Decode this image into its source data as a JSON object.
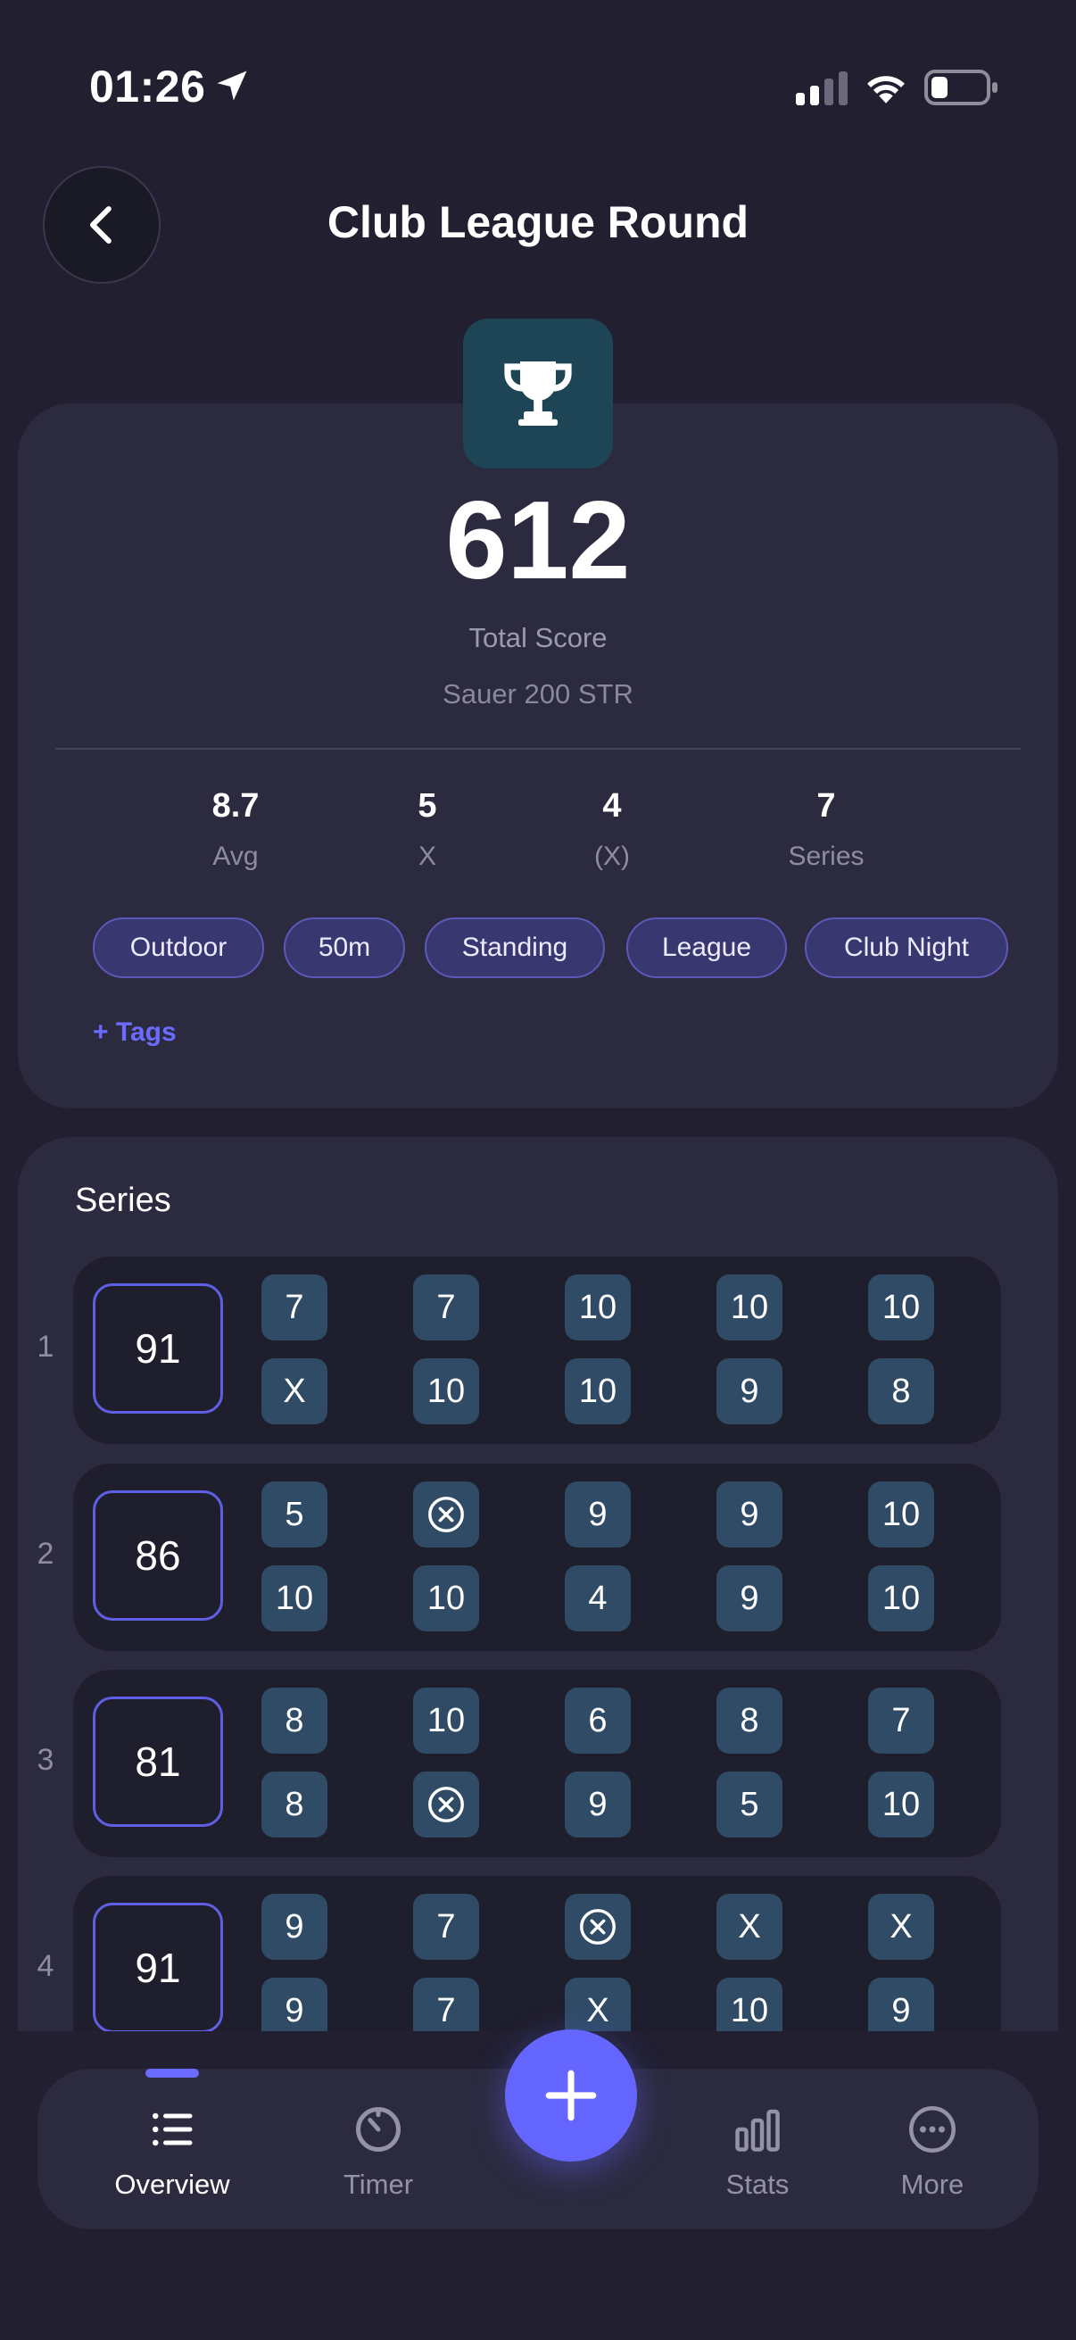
{
  "status_bar": {
    "time": "01:26"
  },
  "header": {
    "title": "Club League Round"
  },
  "summary": {
    "total_score": "612",
    "total_label": "Total Score",
    "rifle": "Sauer 200 STR",
    "stats": [
      {
        "value": "8.7",
        "label": "Avg"
      },
      {
        "value": "5",
        "label": "X"
      },
      {
        "value": "4",
        "label": "(X)"
      },
      {
        "value": "7",
        "label": "Series"
      }
    ],
    "tags": [
      "Outdoor",
      "50m",
      "Standing",
      "League",
      "Club Night"
    ],
    "add_tags_label": "+ Tags"
  },
  "series_section": {
    "title": "Series",
    "rows": [
      {
        "number": "1",
        "total": "91",
        "top": [
          "7",
          "7",
          "10",
          "10",
          "10"
        ],
        "bottom": [
          "X",
          "10",
          "10",
          "9",
          "8"
        ]
      },
      {
        "number": "2",
        "total": "86",
        "top": [
          "5",
          "",
          "9",
          "9",
          "10"
        ],
        "bottom": [
          "10",
          "10",
          "4",
          "9",
          "10"
        ]
      },
      {
        "number": "3",
        "total": "81",
        "top": [
          "8",
          "10",
          "6",
          "8",
          "7"
        ],
        "bottom": [
          "8",
          "",
          "9",
          "5",
          "10"
        ]
      },
      {
        "number": "4",
        "total": "91",
        "top": [
          "9",
          "7",
          "",
          "X",
          "X"
        ],
        "bottom": [
          "9",
          "7",
          "X",
          "10",
          "9"
        ]
      }
    ]
  },
  "nav": {
    "items": [
      {
        "label": "Overview",
        "icon": "list-icon"
      },
      {
        "label": "Timer",
        "icon": "timer-icon"
      },
      {
        "label": "Stats",
        "icon": "bar-chart-icon"
      },
      {
        "label": "More",
        "icon": "more-icon"
      }
    ],
    "active": "Overview"
  },
  "colors": {
    "background": "#211f30",
    "card": "#2c2a3e",
    "accent": "#6466ff",
    "shot_tile": "#2f4b66",
    "trophy_badge": "#1e4556"
  }
}
